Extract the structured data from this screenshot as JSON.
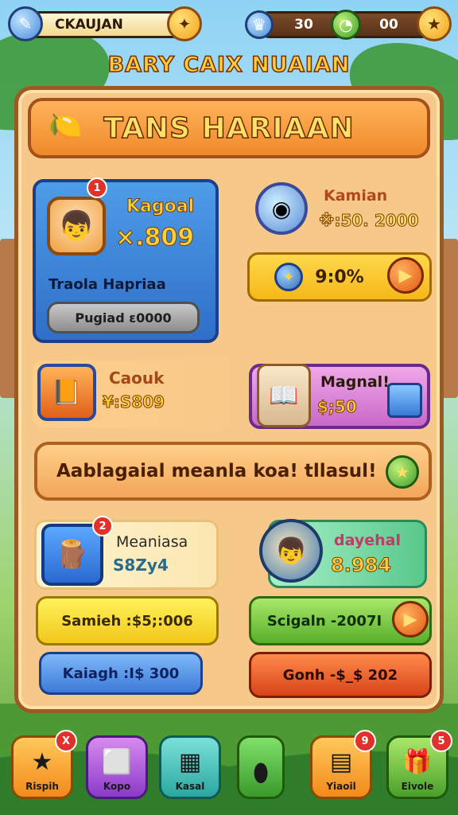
{
  "topbar": {
    "player_name": "CKAUJAN",
    "resource_1": "30",
    "resource_2": "00"
  },
  "game_title": "BARY CAIX NUAIAN",
  "panel": {
    "title": "TANS HARIAAN"
  },
  "featured": {
    "name": "Kagoal",
    "value": "×.809",
    "subtitle": "Traola Hapriaa",
    "button": "Pugiad ε0000",
    "badge": "1"
  },
  "kamian": {
    "name": "Kamian",
    "price": "※:50. 2000",
    "progress_label": "9:0%",
    "progress": 0.9
  },
  "cooik": {
    "name": "Caouk",
    "price": "¥:S809"
  },
  "magnal": {
    "name": "Magnal!",
    "price": "$;50"
  },
  "banner": {
    "text": "Aablagaial meanla koa! tllasul!"
  },
  "meaniosa": {
    "name": "Meaniasa",
    "value": "S8Zy4",
    "badge": "2",
    "button_yellow": "Samieh :$5;:006",
    "button_blue": "Kaiagh :I$ 300"
  },
  "dayehal": {
    "name": "dayehal",
    "value": "8.984",
    "button_green": "Scigaln -2007I",
    "button_red": "Gonh -$_$ 202"
  },
  "nav": [
    {
      "label": "Rispih",
      "badge": "X"
    },
    {
      "label": "Kopo",
      "badge": ""
    },
    {
      "label": "Kasal",
      "badge": ""
    },
    {
      "label": "",
      "badge": ""
    },
    {
      "label": "Yiaoil",
      "badge": "9"
    },
    {
      "label": "Eivole",
      "badge": "5"
    }
  ]
}
